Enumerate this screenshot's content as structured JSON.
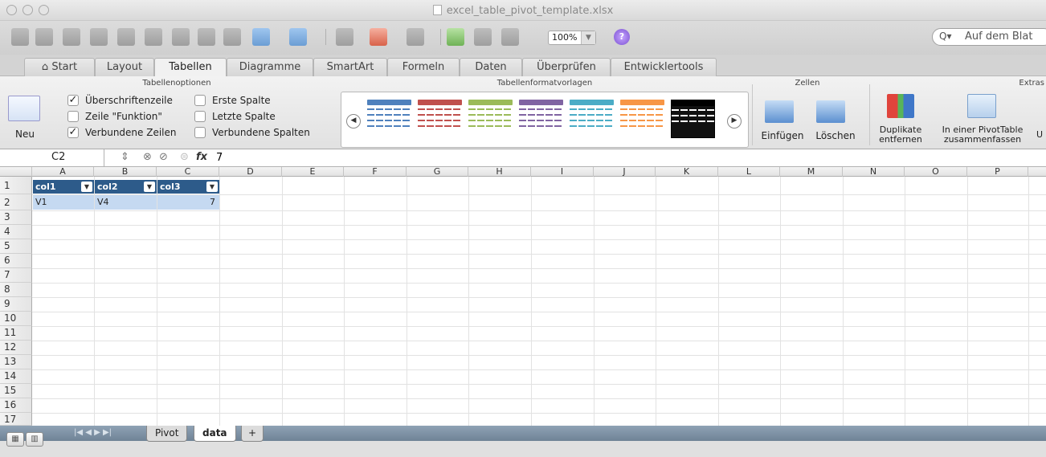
{
  "window": {
    "title": "excel_table_pivot_template.xlsx"
  },
  "toolbar": {
    "zoom": "100%",
    "search_placeholder": "Auf dem Blat"
  },
  "tabs": [
    "Start",
    "Layout",
    "Tabellen",
    "Diagramme",
    "SmartArt",
    "Formeln",
    "Daten",
    "Überprüfen",
    "Entwicklertools"
  ],
  "ribbon": {
    "groups": {
      "options": "Tabellenoptionen",
      "styles": "Tabellenformatvorlagen",
      "cells": "Zellen",
      "extras": "Extras"
    },
    "new_label": "Neu",
    "options": [
      {
        "label": "Überschriftenzeile",
        "checked": true,
        "mark": "✓"
      },
      {
        "label": "Zeile \"Funktion\"",
        "checked": false,
        "mark": ""
      },
      {
        "label": "Verbundene Zeilen",
        "checked": true,
        "mark": "✓"
      },
      {
        "label": "Erste Spalte",
        "checked": false,
        "mark": ""
      },
      {
        "label": "Letzte Spalte",
        "checked": false,
        "mark": ""
      },
      {
        "label": "Verbundene Spalten",
        "checked": false,
        "mark": ""
      }
    ],
    "insert": "Einfügen",
    "delete": "Löschen",
    "dup1": "Duplikate",
    "dup2": "entfernen",
    "pivot1": "In einer PivotTable",
    "pivot2": "zusammenfassen",
    "cut": "U",
    "style_colors": [
      "#4f81bd",
      "#c0504d",
      "#9bbb59",
      "#8064a2",
      "#4bacc6",
      "#f79646",
      "#000000"
    ]
  },
  "formula_bar": {
    "cell": "C2",
    "fx": "fx",
    "value": "7"
  },
  "columns": [
    "A",
    "B",
    "C",
    "D",
    "E",
    "F",
    "G",
    "H",
    "I",
    "J",
    "K",
    "L",
    "M",
    "N",
    "O",
    "P"
  ],
  "rows": [
    "1",
    "2",
    "3",
    "4",
    "5",
    "6",
    "7",
    "8",
    "9",
    "10",
    "11",
    "12",
    "13",
    "14",
    "15",
    "16",
    "17"
  ],
  "table": {
    "headers": [
      "col1",
      "col2",
      "col3"
    ],
    "row": [
      "V1",
      "V4",
      "7"
    ]
  },
  "sheets": {
    "tabs": [
      "Pivot",
      "data"
    ],
    "active": "data",
    "add": "+"
  }
}
